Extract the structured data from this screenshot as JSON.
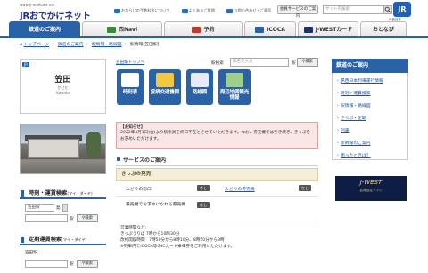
{
  "header": {
    "url_text": "www.jr-odekake.net",
    "logo_text": "JRおでかけネット",
    "top_links": [
      "おからじの手数料金について",
      "よくあるご質問",
      "お問い合わせ・ご意見"
    ],
    "member_button": "会員サービスのご案内",
    "site_search_placeholder": "サイト内検索",
    "jr_logo": "JR",
    "jr_logo_sub": "JR西日本"
  },
  "nav": {
    "tabs": [
      {
        "label": "鉄道のご案内",
        "active": true
      },
      {
        "label": "西Navi",
        "active": false
      },
      {
        "label": "予約",
        "active": false
      },
      {
        "label": "ICOCA",
        "active": false
      },
      {
        "label": "J-WESTカード",
        "active": false
      },
      {
        "label": "おとなび",
        "active": false
      }
    ]
  },
  "breadcrumb": [
    "トップページ",
    "鉄道のご案内",
    "駅情報・路線図",
    "駅情報(笠田駅)"
  ],
  "station": {
    "badge": "JR",
    "name": "笠田",
    "kana": "かせだ",
    "romaji": "Kaseda"
  },
  "sidebar": {
    "timetable_title": "時刻・運賃検索",
    "timetable_note": "(マイ・ダイヤ)",
    "from_value": "笠田駅",
    "from_suffix": "発",
    "station_suffix": "駅",
    "search_button": "検索",
    "commuter_title": "定期運賃検索",
    "commuter_note": "(マイ・ダイヤ)",
    "commuter_from": "笠田駅"
  },
  "main": {
    "top_link": "笠田駅トップへ",
    "keyword_label": "駅検索",
    "keyword_placeholder": "駅名を入力",
    "keyword_suffix": "駅",
    "keyword_button": "検索",
    "icon_buttons": [
      {
        "label": "時刻表",
        "icon": "timetable-icon"
      },
      {
        "label": "接続交通機関",
        "icon": "bus-icon"
      },
      {
        "label": "路線図",
        "icon": "route-map-icon"
      },
      {
        "label": "周辺地図観光情報",
        "icon": "map-icon"
      }
    ],
    "notice": {
      "title": "【お知らせ】",
      "body": "2022年4月1日(金)より駅係員を終日不在とさせていただきます。なお、券売機では引き続き、きっぷをお求めいただけます。"
    },
    "service_title": "サービスのご案内",
    "sales_title": "きっぷの発売",
    "rows": [
      {
        "left": "みどりの窓口",
        "left_badge": "なし",
        "right": "みどりの券売機",
        "right_badge": "なし"
      },
      {
        "left": "券売機でお求めになれる券売機",
        "left_badge": "なし",
        "right": "",
        "right_badge": ""
      }
    ],
    "hours_lines": [
      "営業時間など:",
      "きっぷうりば 7時から10時30分",
      "改札開錠時間　7時50分から8時10分、8時50分から9時",
      "※列車内でICOCA等のICカード乗車券をご利用いただけます。"
    ]
  },
  "right_col": {
    "title": "鉄道のご案内",
    "items": [
      "JR西日本列車運行情報",
      "時刻・運賃検索",
      "駅情報・路線図",
      "きっぷ・定期",
      "列車",
      "新幹線のご案内",
      "困ったときは？"
    ]
  },
  "banner": {
    "title": "J-WEST",
    "sub": "会員限定プラン"
  }
}
